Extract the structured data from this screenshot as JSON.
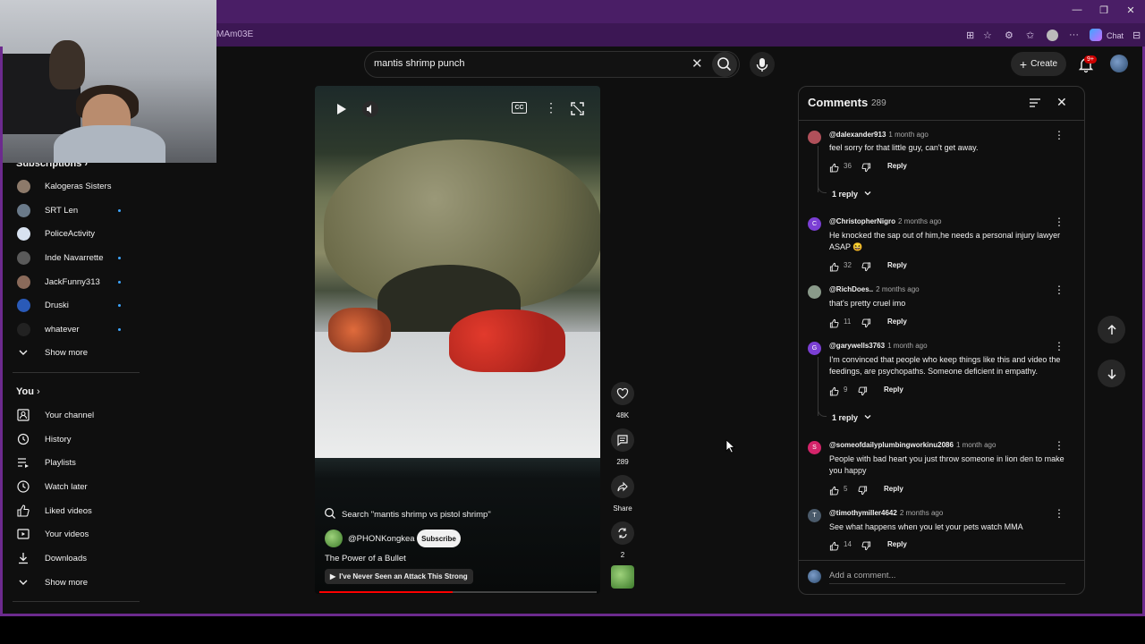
{
  "browser": {
    "url_fragment": "MAm03E",
    "chat_label": "Chat"
  },
  "header": {
    "search_value": "mantis shrimp punch",
    "create_label": "Create",
    "notification_badge": "9+"
  },
  "sidebar": {
    "subscriptions_label": "Subscriptions",
    "subscriptions": [
      {
        "label": "Kalogeras Sisters",
        "dot": false,
        "color": "#8d7a6a"
      },
      {
        "label": "SRT Len",
        "dot": true,
        "color": "#6a7a8a"
      },
      {
        "label": "PoliceActivity",
        "dot": false,
        "color": "#d8e2f0"
      },
      {
        "label": "Inde Navarrette",
        "dot": true,
        "color": "#5a5a5a"
      },
      {
        "label": "JackFunny313",
        "dot": true,
        "color": "#8a6a5a"
      },
      {
        "label": "Druski",
        "dot": true,
        "color": "#2a5ab8"
      },
      {
        "label": "whatever",
        "dot": true,
        "color": "#222"
      }
    ],
    "show_more_1": "Show more",
    "you_label": "You",
    "you_items": [
      {
        "label": "Your channel",
        "icon": "person-icon"
      },
      {
        "label": "History",
        "icon": "history-icon"
      },
      {
        "label": "Playlists",
        "icon": "playlists-icon"
      },
      {
        "label": "Watch later",
        "icon": "clock-icon"
      },
      {
        "label": "Liked videos",
        "icon": "thumbs-up-icon"
      },
      {
        "label": "Your videos",
        "icon": "play-box-icon"
      },
      {
        "label": "Downloads",
        "icon": "download-icon"
      }
    ],
    "show_more_2": "Show more"
  },
  "video": {
    "search_hint": "Search \"mantis shrimp vs pistol shrimp\"",
    "channel": "@PHONKongkea",
    "subscribe_label": "Subscribe",
    "title": "The Power of a Bullet",
    "chip_label": "I've Never Seen an Attack This Strong",
    "progress_fraction": 0.48
  },
  "actions": {
    "likes": "48K",
    "comments": "289",
    "share": "Share",
    "remix": "2"
  },
  "comments": {
    "title": "Comments",
    "count": "289",
    "add_placeholder": "Add a comment...",
    "reply_label": "Reply",
    "items": [
      {
        "author": "@dalexander913",
        "time": "1 month ago",
        "text": "feel sorry for that little guy, can't get away.",
        "likes": "36",
        "replies": "1 reply",
        "avatar_color": "#b0505a",
        "initial": ""
      },
      {
        "author": "@ChristopherNigro",
        "time": "2 months ago",
        "text": "He knocked the sap out of him,he needs a personal injury lawyer ASAP 😆",
        "likes": "32",
        "replies": "",
        "avatar_color": "#7b3fd4",
        "initial": "C"
      },
      {
        "author": "@RichDoes..",
        "time": "2 months ago",
        "text": "that's pretty cruel imo",
        "likes": "11",
        "replies": "",
        "avatar_color": "#8a9a8a",
        "initial": ""
      },
      {
        "author": "@garywells3763",
        "time": "1 month ago",
        "text": "I'm convinced that people who keep things like this and video the feedings, are psychopaths. Someone deficient in empathy.",
        "likes": "9",
        "replies": "1 reply",
        "avatar_color": "#7b3fd4",
        "initial": "G"
      },
      {
        "author": "@someofdailyplumbingworkinu2086",
        "time": "1 month ago",
        "text": "People with bad heart you just throw  someone in lion den to make you happy",
        "likes": "5",
        "replies": "",
        "avatar_color": "#d4246a",
        "initial": "S"
      },
      {
        "author": "@timothymiller4642",
        "time": "2 months ago",
        "text": "See what happens when you let your pets watch MMA",
        "likes": "14",
        "replies": "",
        "avatar_color": "#4a5a6a",
        "initial": "T"
      }
    ]
  }
}
